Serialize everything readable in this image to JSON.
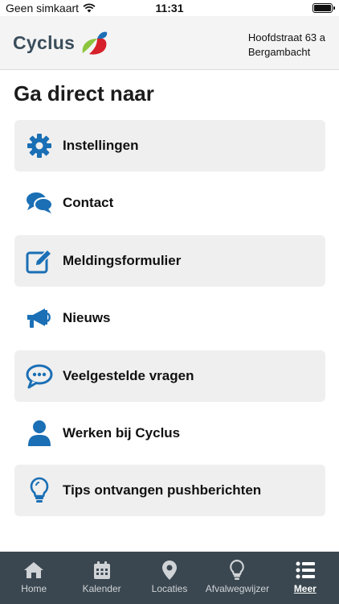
{
  "status_bar": {
    "carrier": "Geen simkaart",
    "time": "11:31"
  },
  "header": {
    "logo_text": "Cyclus",
    "address_line1": "Hoofdstraat 63 a",
    "address_line2": "Bergambacht"
  },
  "page": {
    "title": "Ga direct naar"
  },
  "menu": {
    "items": [
      {
        "label": "Instellingen",
        "icon": "gear-icon"
      },
      {
        "label": "Contact",
        "icon": "chat-bubbles-icon"
      },
      {
        "label": "Meldingsformulier",
        "icon": "edit-form-icon"
      },
      {
        "label": "Nieuws",
        "icon": "megaphone-icon"
      },
      {
        "label": "Veelgestelde vragen",
        "icon": "speech-bubble-dots-icon"
      },
      {
        "label": "Werken bij Cyclus",
        "icon": "user-icon"
      },
      {
        "label": "Tips ontvangen pushberichten",
        "icon": "lightbulb-icon"
      }
    ]
  },
  "tab_bar": {
    "tabs": [
      {
        "label": "Home",
        "icon": "home-icon",
        "active": false
      },
      {
        "label": "Kalender",
        "icon": "calendar-icon",
        "active": false
      },
      {
        "label": "Locaties",
        "icon": "map-pin-icon",
        "active": false
      },
      {
        "label": "Afvalwegwijzer",
        "icon": "lightbulb-icon",
        "active": false
      },
      {
        "label": "Meer",
        "icon": "list-icon",
        "active": true
      }
    ]
  },
  "colors": {
    "icon_blue": "#1a6fb5",
    "tab_bar_bg": "#3a4750",
    "header_bg": "#f4f4f4",
    "shaded_item_bg": "#efefef",
    "logo_text": "#3a4d5b"
  }
}
